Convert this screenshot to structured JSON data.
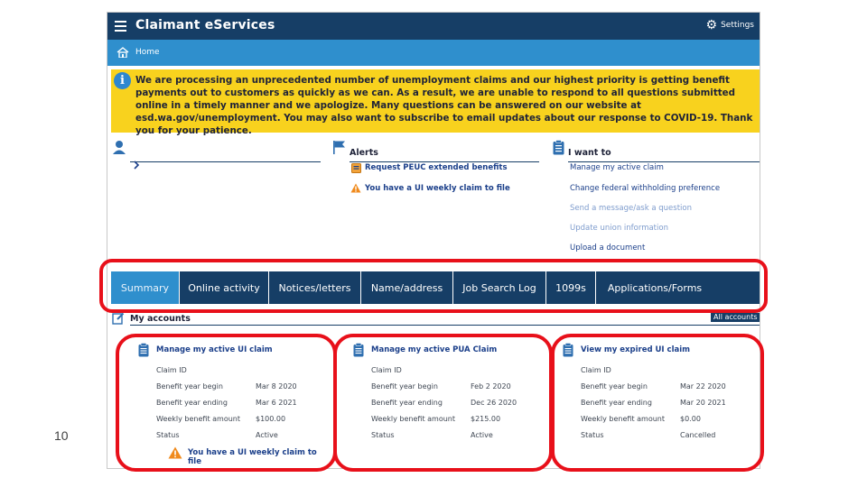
{
  "slide_number": "10",
  "app": {
    "title": "Claimant eServices",
    "settings_label": "Settings",
    "breadcrumb_home": "Home"
  },
  "banner": {
    "text": "We are processing an unprecedented number of unemployment claims and our highest priority is getting benefit payments out to customers as quickly as we can. As a result, we are unable to respond to all questions submitted online in a timely manner and we apologize. Many questions can be answered on our website at esd.wa.gov/unemployment. You may also want to subscribe to email updates about our response to COVID-19. Thank you for your patience."
  },
  "alerts": {
    "heading": "Alerts",
    "items": [
      "Request PEUC extended benefits",
      "You have a UI weekly claim to file"
    ]
  },
  "i_want_to": {
    "heading": "I want to",
    "items": [
      "Manage my active claim",
      "Change federal withholding preference",
      "Send a message/ask a question",
      "Update union information",
      "Upload a document"
    ]
  },
  "tabs": [
    "Summary",
    "Online activity",
    "Notices/letters",
    "Name/address",
    "Job Search Log",
    "1099s",
    "Applications/Forms"
  ],
  "active_tab": "Summary",
  "accounts": {
    "heading": "My accounts",
    "all_accounts_label": "All accounts",
    "cards": [
      {
        "title": "Manage my active UI claim",
        "rows": [
          {
            "label": "Claim ID",
            "value": ""
          },
          {
            "label": "Benefit year begin",
            "value": "Mar 8 2020"
          },
          {
            "label": "Benefit year ending",
            "value": "Mar 6 2021"
          },
          {
            "label": "Weekly benefit amount",
            "value": "$100.00"
          },
          {
            "label": "Status",
            "value": "Active"
          }
        ],
        "alert": "You have a UI weekly claim to file"
      },
      {
        "title": "Manage my active PUA Claim",
        "rows": [
          {
            "label": "Claim ID",
            "value": ""
          },
          {
            "label": "Benefit year begin",
            "value": "Feb 2 2020"
          },
          {
            "label": "Benefit year ending",
            "value": "Dec 26 2020"
          },
          {
            "label": "Weekly benefit amount",
            "value": "$215.00"
          },
          {
            "label": "Status",
            "value": "Active"
          }
        ]
      },
      {
        "title": "View my expired UI claim",
        "rows": [
          {
            "label": "Claim ID",
            "value": ""
          },
          {
            "label": "Benefit year begin",
            "value": "Mar 22 2020"
          },
          {
            "label": "Benefit year ending",
            "value": "Mar 20 2021"
          },
          {
            "label": "Weekly benefit amount",
            "value": "$0.00"
          },
          {
            "label": "Status",
            "value": "Cancelled"
          }
        ]
      }
    ]
  },
  "colors": {
    "nav_dark": "#163e66",
    "nav_light": "#2f8fcd",
    "banner_yellow": "#f8d21e",
    "highlight_red": "#e8101a",
    "link_blue": "#1b3f8a"
  }
}
